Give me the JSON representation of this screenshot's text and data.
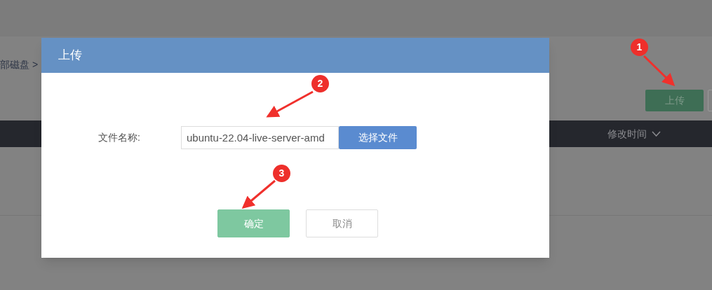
{
  "page": {
    "breadcrumb": "部磁盘 >",
    "upload_button": "上传",
    "columns": [
      {
        "label": "修改时间"
      }
    ]
  },
  "dialog": {
    "title": "上传",
    "field": {
      "label": "文件名称:",
      "value": "ubuntu-22.04-live-server-amd"
    },
    "choose_button": "选择文件",
    "buttons": [
      {
        "label": "确定",
        "kind": "primary"
      },
      {
        "label": "取消",
        "kind": "secondary"
      }
    ]
  },
  "annotations": [
    "1",
    "2",
    "3"
  ]
}
